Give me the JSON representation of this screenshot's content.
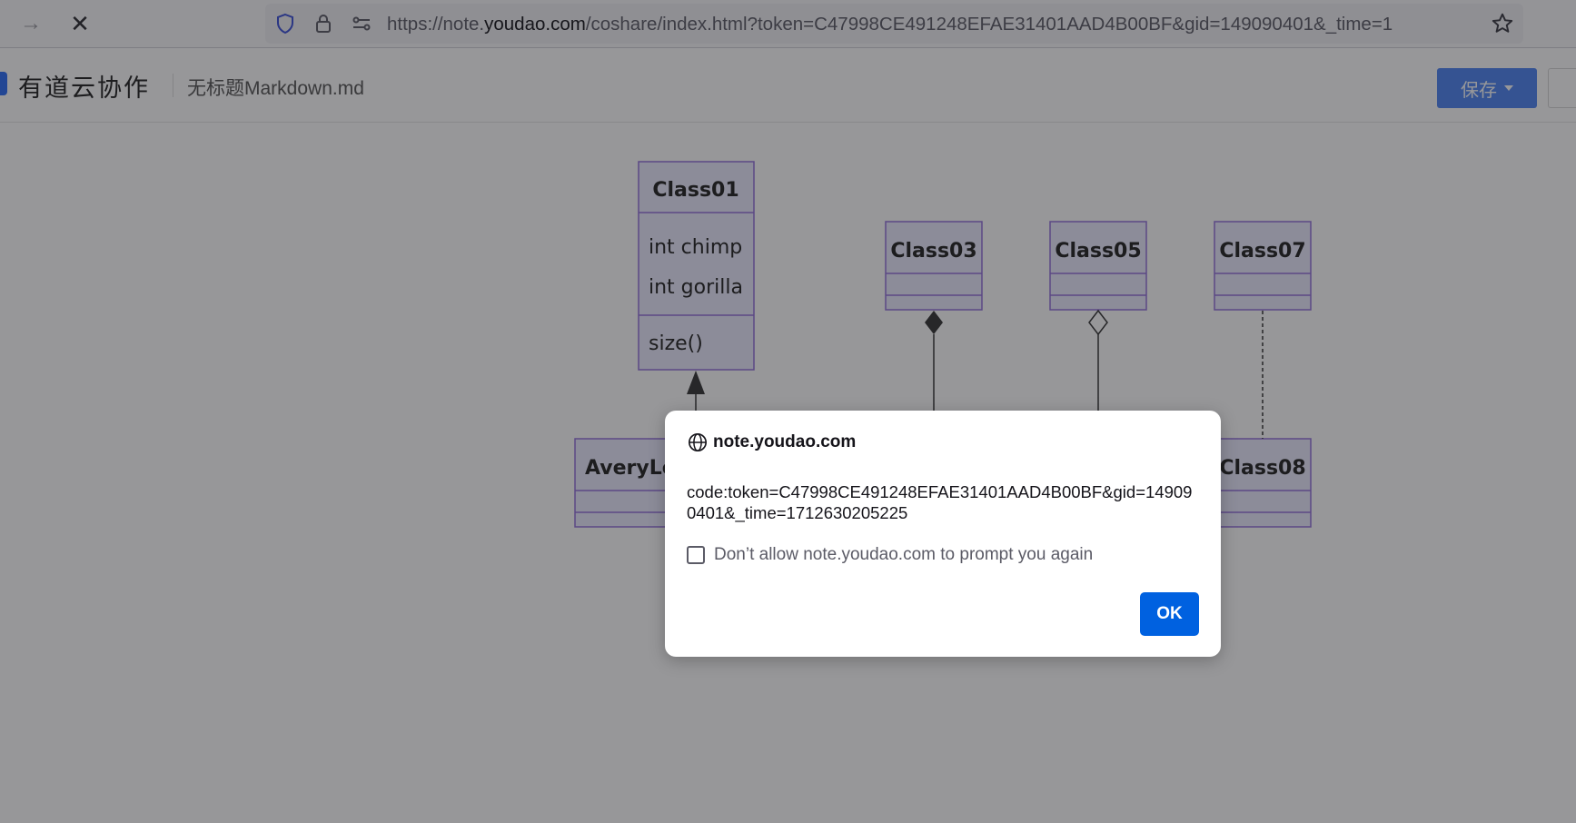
{
  "browser": {
    "url_prefix": "https://note.",
    "url_domain": "youdao.com",
    "url_suffix": "/coshare/index.html?token=C47998CE491248EFAE31401AAD4B00BF&gid=149090401&_time=1"
  },
  "app": {
    "name": "有道云协作",
    "doc_title": "无标题Markdown.md",
    "save_label": "保存"
  },
  "diagram": {
    "class01": {
      "name": "Class01",
      "fields": [
        "int chimp",
        "int gorilla"
      ],
      "methods": [
        "size()"
      ]
    },
    "class03": {
      "name": "Class03"
    },
    "class05": {
      "name": "Class05"
    },
    "class07": {
      "name": "Class07"
    },
    "class_avery": {
      "name": "AveryLo"
    },
    "class08": {
      "name": "Class08"
    }
  },
  "dialog": {
    "origin": "note.youdao.com",
    "message": "code:token=C47998CE491248EFAE31401AAD4B00BF&gid=149090401&_time=1712630205225",
    "checkbox_label": "Don’t allow note.youdao.com to prompt you again",
    "ok_label": "OK"
  },
  "colors": {
    "uml_fill": "#ECECFF",
    "uml_stroke": "#9370DB",
    "ok_button": "#0061e0",
    "save_button": "#4d84f2"
  }
}
